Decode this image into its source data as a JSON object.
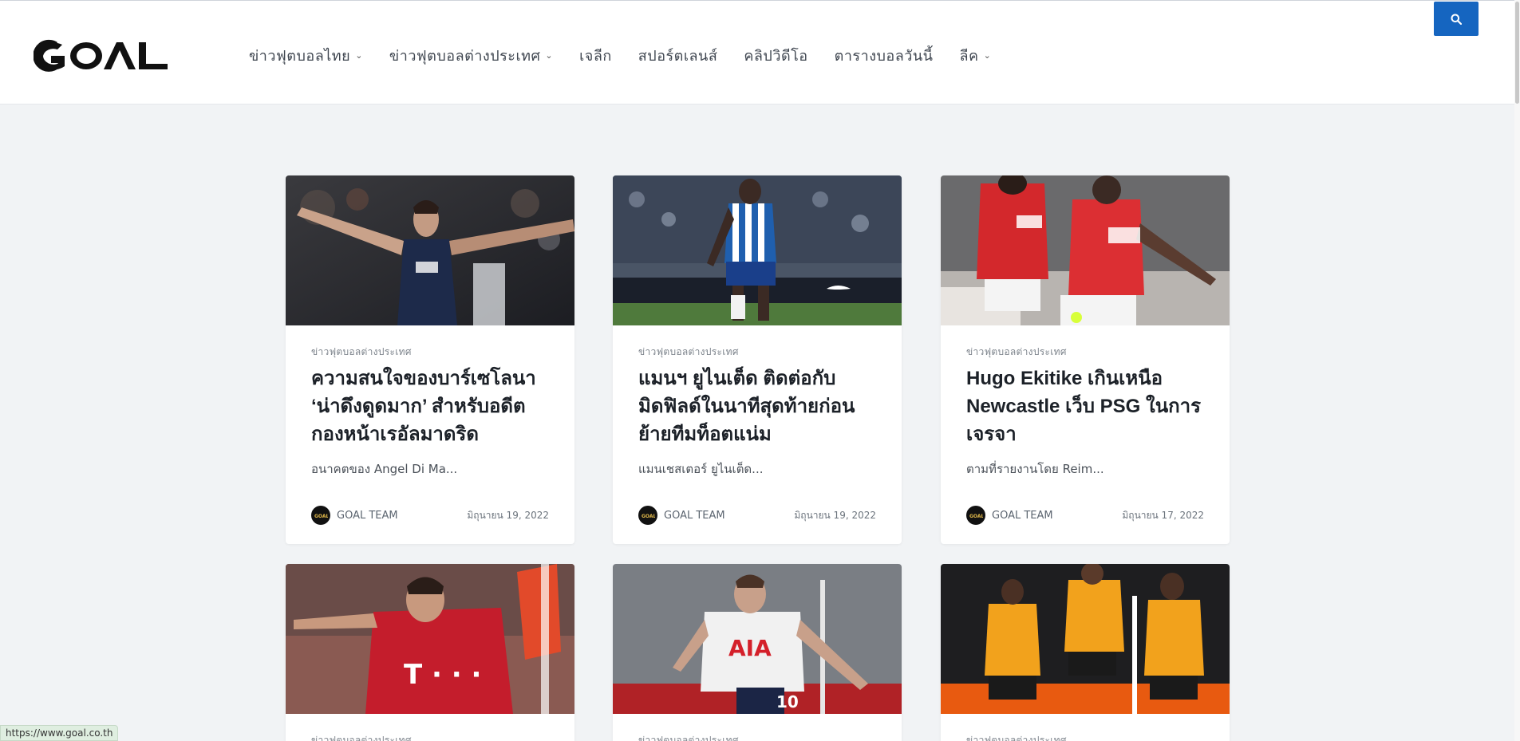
{
  "header": {
    "logo_text": "GOAL",
    "nav": [
      {
        "label": "ข่าวฟุตบอลไทย",
        "has_dropdown": true
      },
      {
        "label": "ข่าวฟุตบอลต่างประเทศ",
        "has_dropdown": true
      },
      {
        "label": "เจลีก",
        "has_dropdown": false
      },
      {
        "label": "สปอร์ตเลนส์",
        "has_dropdown": false
      },
      {
        "label": "คลิปวิดีโอ",
        "has_dropdown": false
      },
      {
        "label": "ตารางบอลวันนี้",
        "has_dropdown": false
      },
      {
        "label": "ลีค",
        "has_dropdown": true
      }
    ],
    "search_icon": "search-icon",
    "accent_color": "#1565c0"
  },
  "cards": [
    {
      "category": "ข่าวฟุตบอลต่างประเทศ",
      "title": "ความสนใจของบาร์เซโลนา ‘น่าดึงดูดมาก’ สำหรับอดีตกองหน้าเรอัลมาดริด",
      "excerpt": "อนาคตของ Angel Di Ma...",
      "author": "GOAL TEAM",
      "date": "มิถุนายน 19, 2022"
    },
    {
      "category": "ข่าวฟุตบอลต่างประเทศ",
      "title": "แมนฯ ยูไนเต็ด ติดต่อกับมิดฟิลด์ในนาทีสุดท้ายก่อนย้ายทีมท็อตแน่ม",
      "excerpt": "แมนเชสเตอร์ ยูไนเต็ด...",
      "author": "GOAL TEAM",
      "date": "มิถุนายน 19, 2022"
    },
    {
      "category": "ข่าวฟุตบอลต่างประเทศ",
      "title": "Hugo Ekitike เกินเหนือ Newcastle เว็บ PSG ในการเจรจา",
      "excerpt": "ตามที่รายงานโดย Reim...",
      "author": "GOAL TEAM",
      "date": "มิถุนายน 17, 2022"
    },
    {
      "category": "ข่าวฟุตบอลต่างประเทศ"
    },
    {
      "category": "ข่าวฟุตบอลต่างประเทศ"
    },
    {
      "category": "ข่าวฟุตบอลต่างประเทศ"
    }
  ],
  "status_bar": {
    "url": "https://www.goal.co.th"
  }
}
